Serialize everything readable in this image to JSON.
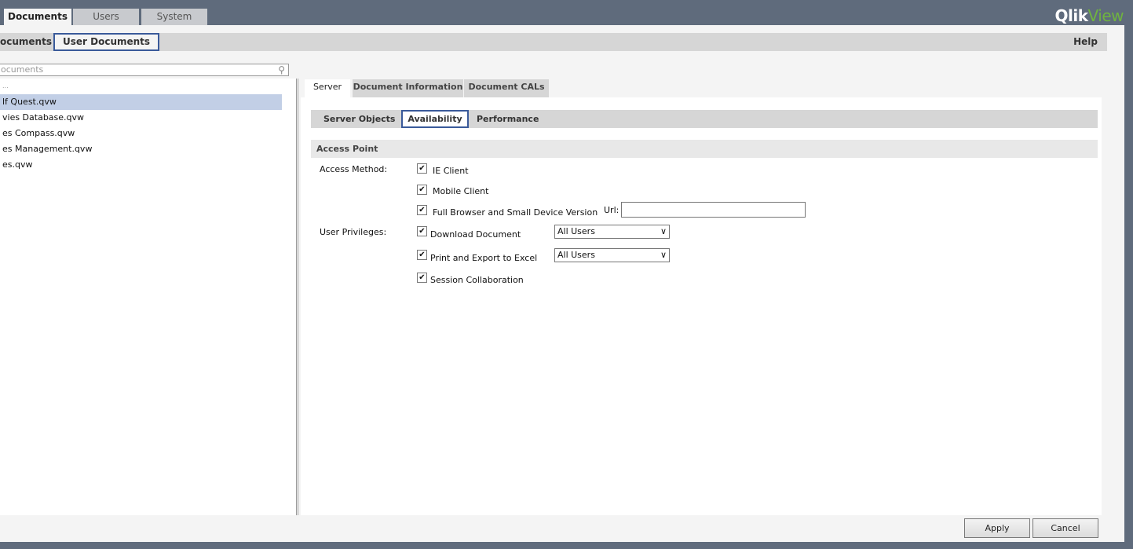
{
  "top_tabs": [
    {
      "label": "Documents",
      "active": true
    },
    {
      "label": "Users"
    },
    {
      "label": "System"
    }
  ],
  "logo": {
    "part1": "Qlik",
    "part2": "View",
    "accent": "#6fb33f"
  },
  "sub_nav": {
    "items": [
      "ocuments",
      "User Documents"
    ],
    "active": "User Documents",
    "help": "Help"
  },
  "search": {
    "placeholder": "ocuments",
    "icon": "search-icon"
  },
  "documents": [
    {
      "name": "..."
    },
    {
      "name": "lf Quest.qvw",
      "selected": true
    },
    {
      "name": "vies Database.qvw"
    },
    {
      "name": "es Compass.qvw"
    },
    {
      "name": "es Management.qvw"
    },
    {
      "name": "es.qvw"
    }
  ],
  "tabs": [
    "Server",
    "Document Information",
    "Document CALs"
  ],
  "sub_tabs": [
    "Server Objects",
    "Availability",
    "Performance"
  ],
  "section": "Access Point",
  "access_method": {
    "label": "Access Method:",
    "options": [
      {
        "label": "IE Client",
        "checked": true
      },
      {
        "label": "Mobile Client",
        "checked": true
      },
      {
        "label": "Full Browser and Small Device Version",
        "checked": true
      }
    ],
    "url_label": "Url:",
    "url_value": ""
  },
  "user_privileges": {
    "label": "User Privileges:",
    "options": [
      {
        "label": "Download Document",
        "checked": true,
        "select": "All Users"
      },
      {
        "label": "Print and Export to Excel",
        "checked": true,
        "select": "All Users"
      },
      {
        "label": "Session Collaboration",
        "checked": true
      }
    ]
  },
  "buttons": {
    "apply": "Apply",
    "cancel": "Cancel"
  }
}
